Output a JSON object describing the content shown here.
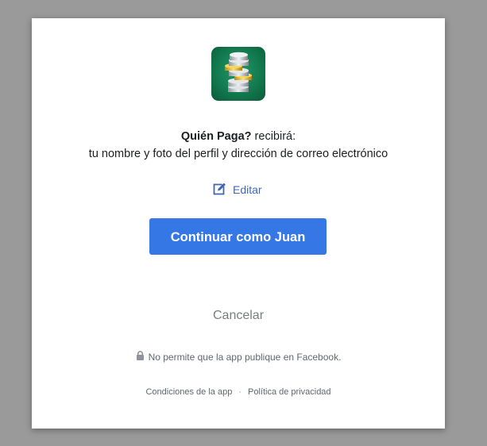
{
  "app": {
    "name": "Quién Paga?",
    "icon": "coin-stack-icon",
    "icon_background": "#137a4f"
  },
  "permissions": {
    "receives_label": "recibirá:",
    "detail": "tu nombre y foto del perfil y dirección de correo electrónico"
  },
  "edit": {
    "icon": "edit-icon",
    "label": "Editar"
  },
  "continue_button": {
    "label": "Continuar como Juan",
    "color": "#3578e5"
  },
  "cancel": {
    "label": "Cancelar"
  },
  "posting_notice": {
    "icon": "lock-icon",
    "text": "No permite que la app publique en Facebook."
  },
  "footer": {
    "terms": "Condiciones de la app",
    "separator": "·",
    "privacy": "Política de privacidad"
  }
}
